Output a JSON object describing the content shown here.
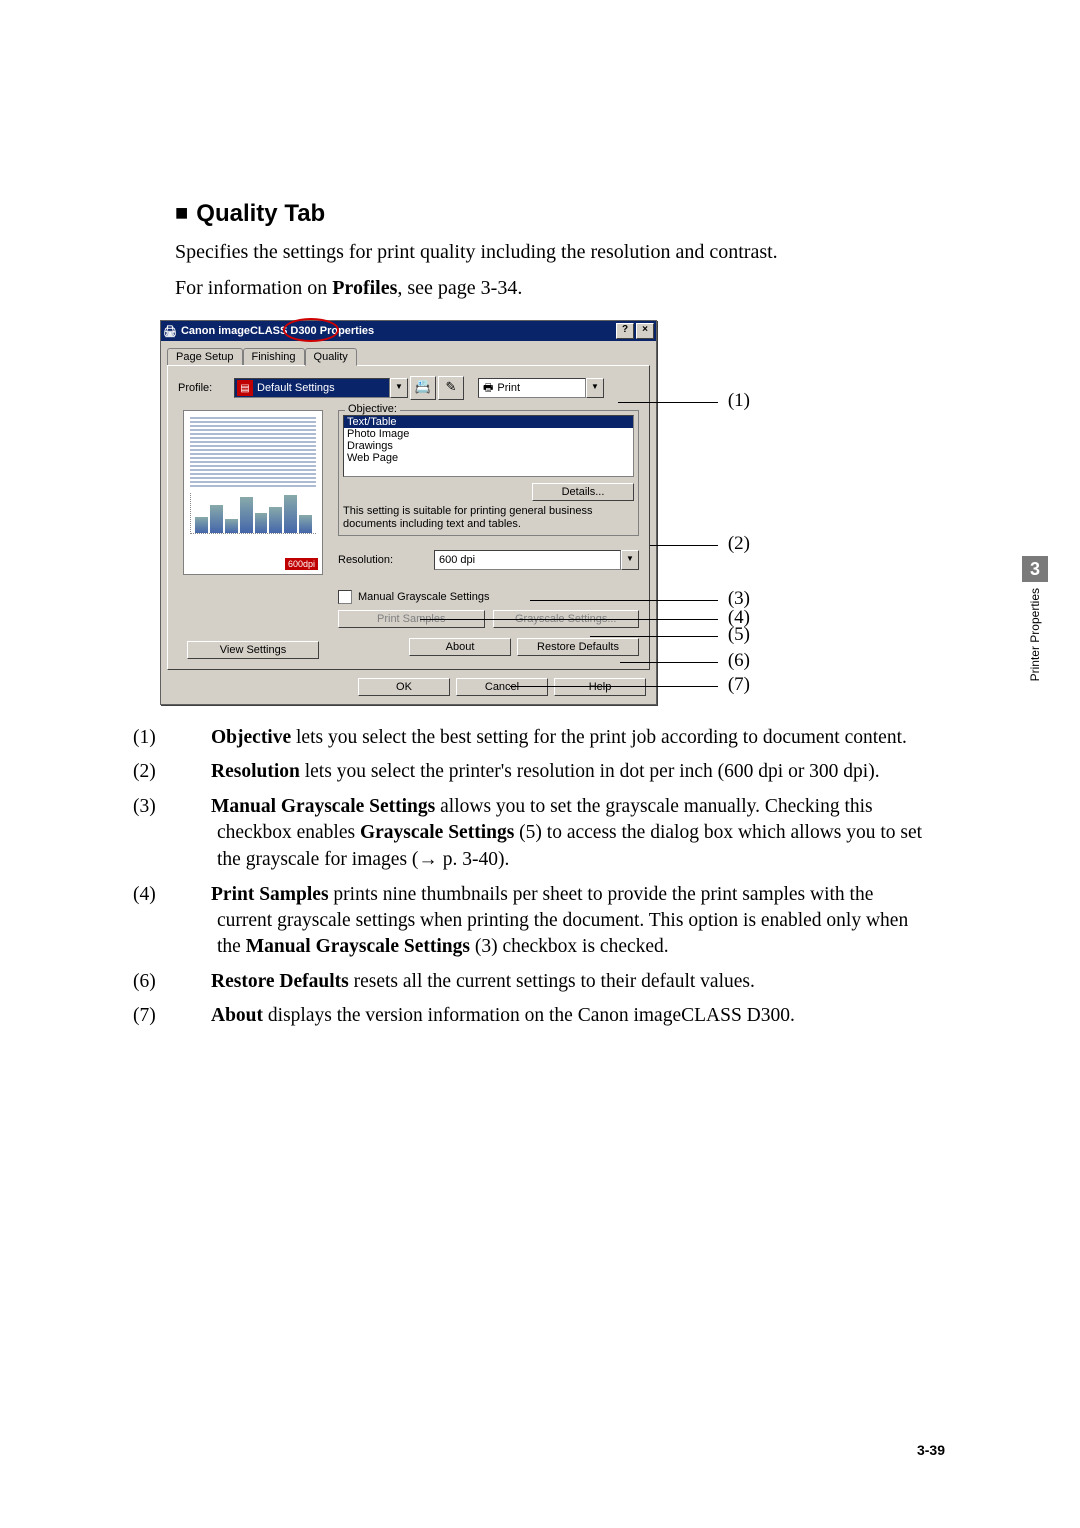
{
  "heading": {
    "marker": "■",
    "text": "Quality Tab"
  },
  "intro1": "Specifies the settings for print quality including the resolution and contrast.",
  "intro2_a": "For information on ",
  "intro2_b": "Profiles",
  "intro2_c": ", see page 3-34.",
  "dialog": {
    "title": "Canon imageCLASS D300 Properties",
    "help_btn": "?",
    "close_btn": "×",
    "tabs": {
      "page_setup": "Page Setup",
      "finishing": "Finishing",
      "quality": "Quality"
    },
    "profile_label": "Profile:",
    "profile_value": "Default Settings",
    "print_combo_label": "Print",
    "printer_icon": "🖶",
    "objective_legend": "Objective:",
    "objective_options": {
      "text_table": "Text/Table",
      "photo_image": "Photo Image",
      "drawings": "Drawings",
      "web_page": "Web Page"
    },
    "details_btn": "Details...",
    "objective_desc": "This setting is suitable for printing general business documents including text and tables.",
    "preview_badge": "600dpi",
    "view_settings_btn": "View Settings",
    "resolution_label": "Resolution:",
    "resolution_value": "600 dpi",
    "manual_gray_label": "Manual Grayscale Settings",
    "print_samples_btn": "Print Samples",
    "grayscale_settings_btn": "Grayscale Settings...",
    "about_btn": "About",
    "restore_btn": "Restore Defaults",
    "ok_btn": "OK",
    "cancel_btn": "Cancel",
    "help_btn2": "Help"
  },
  "callouts": {
    "c1": "(1)",
    "c2": "(2)",
    "c3": "(3)",
    "c4": "(4)",
    "c5": "(5)",
    "c6": "(6)",
    "c7": "(7)"
  },
  "desc": {
    "d1": {
      "n": "(1)",
      "b": "Objective",
      "t": " lets you select the best setting for the print job according to document content."
    },
    "d2": {
      "n": "(2)",
      "b": "Resolution",
      "t": " lets you select the printer's resolution in dot per inch (600 dpi or 300 dpi)."
    },
    "d3": {
      "n": "(3)",
      "b1": "Manual Grayscale Settings",
      "t1": " allows you to set the grayscale manually. Checking this checkbox enables ",
      "b2": "Grayscale Settings",
      "t2": " (5) to access the dialog box which allows you to set the grayscale for images (",
      "arrow": "→",
      "t3": " p. 3-40)."
    },
    "d4": {
      "n": "(4)",
      "b1": "Print Samples",
      "t1": " prints nine thumbnails per sheet to provide the print samples with the current grayscale settings when printing the document. This option is enabled only when the ",
      "b2": "Manual Grayscale Settings",
      "t2": " (3) checkbox is checked."
    },
    "d6": {
      "n": "(6)",
      "b": "Restore Defaults",
      "t": " resets all the current settings to their default values."
    },
    "d7": {
      "n": "(7)",
      "b": "About",
      "t": " displays the version information on the Canon imageCLASS D300."
    }
  },
  "side": {
    "num": "3",
    "label": "Printer Properties"
  },
  "page_number": "3-39"
}
